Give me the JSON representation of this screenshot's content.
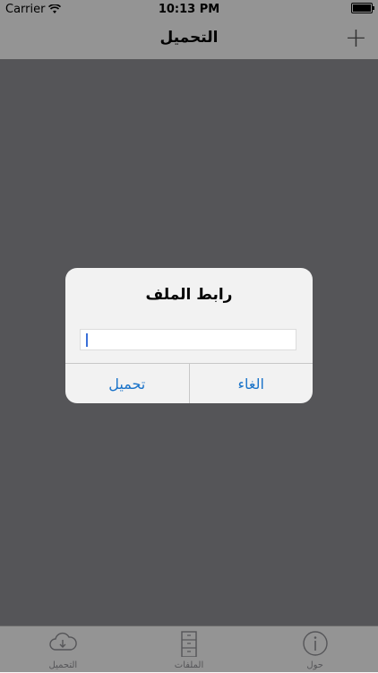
{
  "statusbar": {
    "carrier": "Carrier",
    "time": "10:13 PM"
  },
  "navbar": {
    "title": "التحميل",
    "add_label": "+"
  },
  "alert": {
    "title": "رابط الملف",
    "input_value": "",
    "buttons": {
      "left": "تحميل",
      "right": "الغاء"
    }
  },
  "tabbar": {
    "items": [
      {
        "label": "التحميل",
        "icon": "cloud-download-icon"
      },
      {
        "label": "الملفات",
        "icon": "filing-cabinet-icon"
      },
      {
        "label": "حول",
        "icon": "info-icon"
      }
    ]
  },
  "colors": {
    "accent": "#1a73c9",
    "background": "#8e8e93",
    "bar": "#f7f7f7"
  }
}
